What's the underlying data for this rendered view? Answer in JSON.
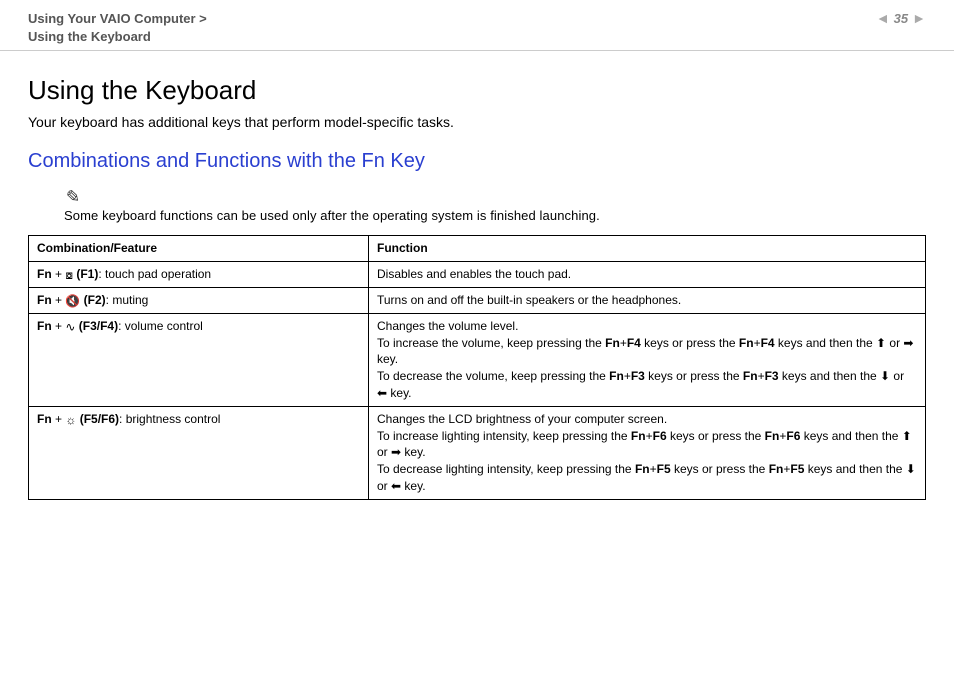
{
  "header": {
    "breadcrumb_line1": "Using Your VAIO Computer >",
    "breadcrumb_line2": "Using the Keyboard",
    "page_number": "35"
  },
  "main": {
    "title": "Using the Keyboard",
    "intro": "Your keyboard has additional keys that perform model-specific tasks.",
    "subtitle": "Combinations and Functions with the Fn Key",
    "note_icon": "✎",
    "note_text": "Some keyboard functions can be used only after the operating system is finished launching.",
    "table": {
      "header_combo": "Combination/Feature",
      "header_function": "Function",
      "rows": [
        {
          "fn_prefix": "Fn",
          "plus": " + ",
          "icon": "touchpad-x-icon",
          "icon_glyph": "⧇",
          "key": " (F1)",
          "suffix": ": touch pad operation",
          "func": "Disables and enables the touch pad."
        },
        {
          "fn_prefix": "Fn",
          "plus": " + ",
          "icon": "mute-icon",
          "icon_glyph": "🔇",
          "key": " (F2)",
          "suffix": ": muting",
          "func": "Turns on and off the built-in speakers or the headphones."
        },
        {
          "fn_prefix": "Fn",
          "plus": " + ",
          "icon": "volume-icon",
          "icon_glyph": "∿",
          "key": " (F3/F4)",
          "suffix": ": volume control",
          "func_line1": "Changes the volume level.",
          "func_inc_a": "To increase the volume, keep pressing the ",
          "func_inc_k1": "Fn",
          "func_inc_plus": "+",
          "func_inc_k2": "F4",
          "func_inc_b": " keys or press the ",
          "func_inc_k3": "Fn",
          "func_inc_k4": "F4",
          "func_inc_c": " keys and then the ",
          "up_arrow": "⬆",
          "or": " or ",
          "right_arrow": "➡",
          "key_word": " key.",
          "func_dec_a": "To decrease the volume, keep pressing the ",
          "func_dec_k1": "Fn",
          "func_dec_k2": "F3",
          "func_dec_b": " keys or press the ",
          "func_dec_k3": "Fn",
          "func_dec_k4": "F3",
          "func_dec_c": " keys and then the ",
          "down_arrow": "⬇",
          "left_arrow": "⬅"
        },
        {
          "fn_prefix": "Fn",
          "plus": " + ",
          "icon": "brightness-icon",
          "icon_glyph": "☼",
          "key": " (F5/F6)",
          "suffix": ": brightness control",
          "func_line1": "Changes the LCD brightness of your computer screen.",
          "func_inc_a": "To increase lighting intensity, keep pressing the ",
          "func_inc_k1": "Fn",
          "func_inc_plus": "+",
          "func_inc_k2": "F6",
          "func_inc_b": " keys or press the ",
          "func_inc_k3": "Fn",
          "func_inc_k4": "F6",
          "func_inc_c": " keys and then the ",
          "up_arrow": "⬆",
          "or": " or ",
          "right_arrow": "➡",
          "key_word": " key.",
          "func_dec_a": "To decrease lighting intensity, keep pressing the ",
          "func_dec_k1": "Fn",
          "func_dec_k2": "F5",
          "func_dec_b": " keys or press the ",
          "func_dec_k3": "Fn",
          "func_dec_k4": "F5",
          "func_dec_c": " keys and then the ",
          "down_arrow": "⬇",
          "left_arrow": "⬅"
        }
      ]
    }
  }
}
